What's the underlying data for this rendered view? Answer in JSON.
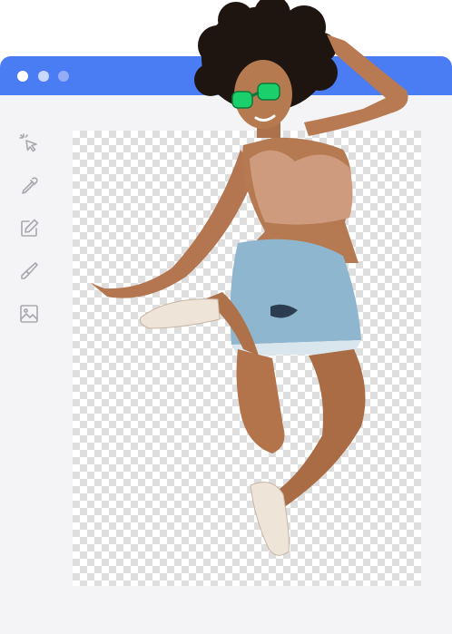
{
  "window": {
    "title_bar_color": "#4a7cf4",
    "window_controls": [
      "close-dot",
      "minimize-dot",
      "maximize-dot"
    ]
  },
  "toolbar": {
    "tools": [
      {
        "icon": "magic-select-icon"
      },
      {
        "icon": "eyedropper-icon"
      },
      {
        "icon": "edit-icon"
      },
      {
        "icon": "brush-icon"
      },
      {
        "icon": "image-icon"
      }
    ]
  },
  "canvas": {
    "background": "transparency-checkerboard",
    "subject": "cutout-photo-jumping-woman"
  }
}
